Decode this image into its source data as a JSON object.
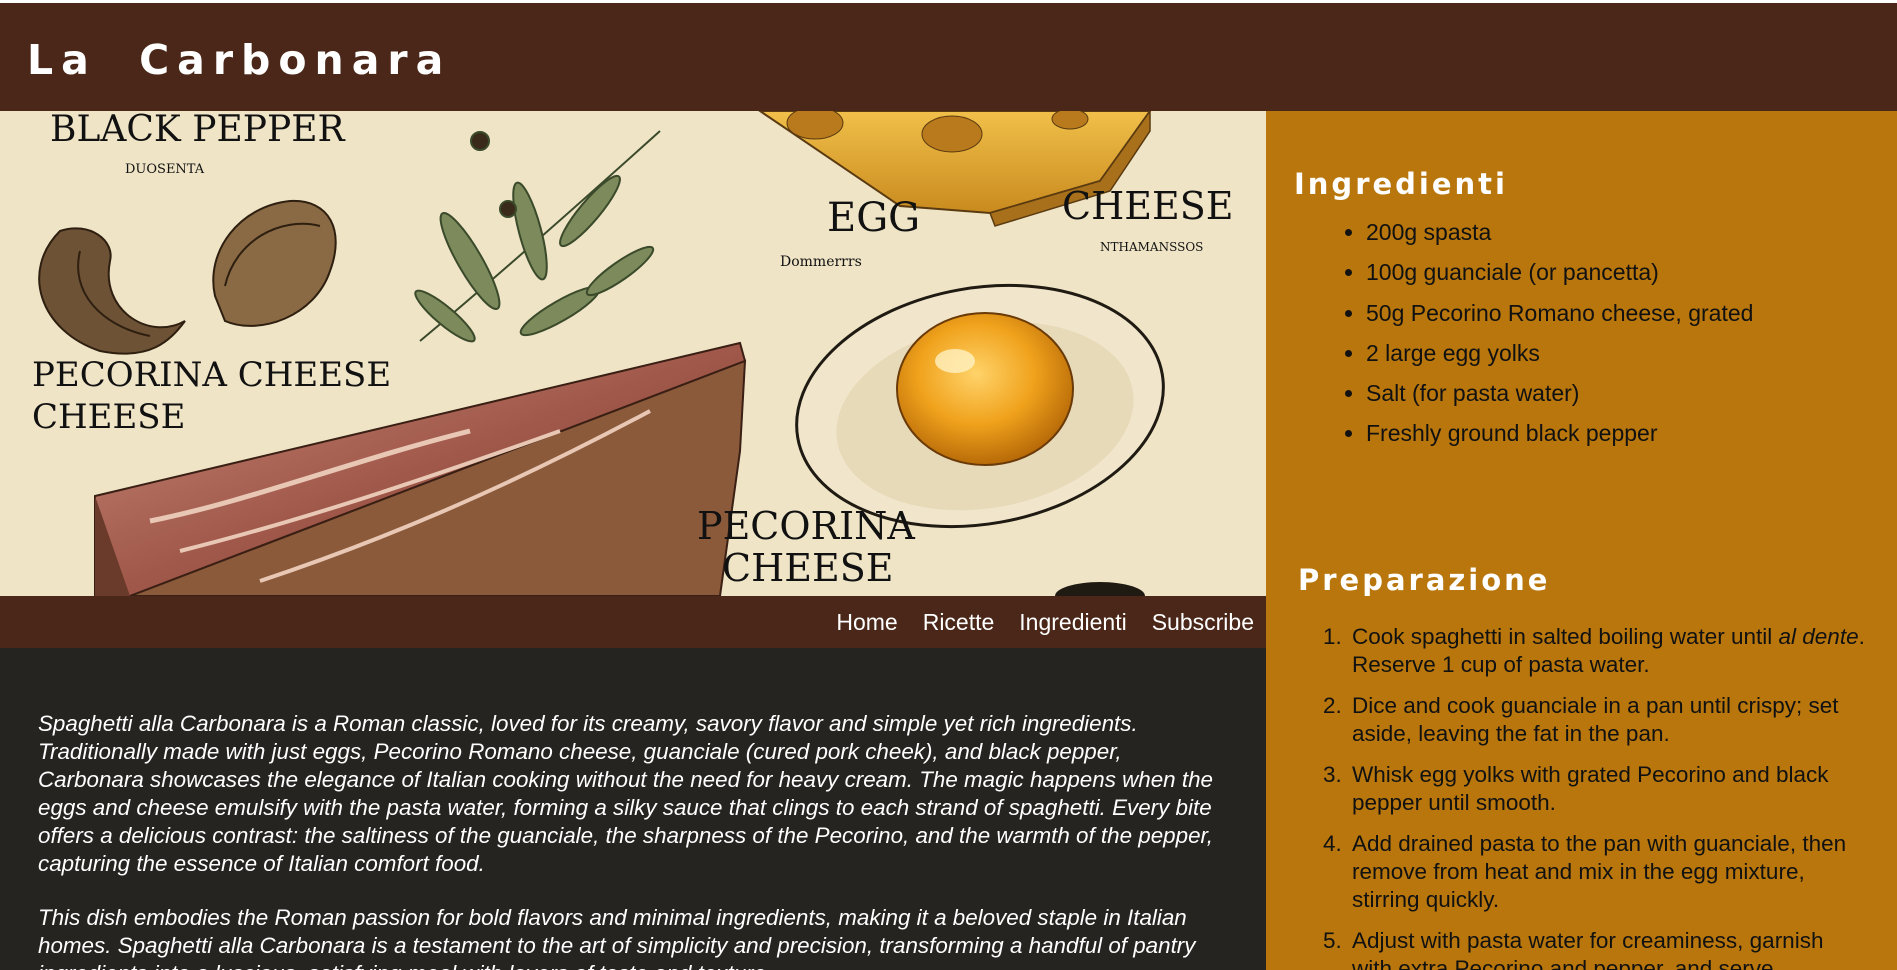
{
  "header": {
    "title": "La Carbonara"
  },
  "hero": {
    "labels": {
      "black_pepper": "BLACK PEPPER",
      "egg": "EGG",
      "cheese": "CHEESE",
      "pecorina_cheese_1_line1": "PECORINA CHEESE",
      "pecorina_cheese_1_line2": "CHEESE",
      "pecorina_cheese_2_line1": "PECORINA",
      "pecorina_cheese_2_line2": "CHEESE"
    },
    "small_captions": {
      "under_pepper": "DUOSENTA",
      "under_egg": "Dommerrrs",
      "under_cheese": "NTHAMANSSOS"
    }
  },
  "nav": {
    "items": [
      "Home",
      "Ricette",
      "Ingredienti",
      "Subscribe"
    ]
  },
  "intro": {
    "paragraph1": "Spaghetti alla Carbonara is a Roman classic, loved for its creamy, savory flavor and simple yet rich ingredients. Traditionally made with just eggs, Pecorino Romano cheese, guanciale (cured pork cheek), and black pepper, Carbonara showcases the elegance of Italian cooking without the need for heavy cream. The magic happens when the eggs and cheese emulsify with the pasta water, forming a silky sauce that clings to each strand of spaghetti. Every bite offers a delicious contrast: the saltiness of the guanciale, the sharpness of the Pecorino, and the warmth of the pepper, capturing the essence of Italian comfort food.",
    "paragraph2": "This dish embodies the Roman passion for bold flavors and minimal ingredients, making it a beloved staple in Italian homes. Spaghetti alla Carbonara is a testament to the art of simplicity and precision, transforming a handful of pantry ingredients into a luscious, satisfying meal with layers of taste and texture."
  },
  "sidebar": {
    "ingredients_title": "Ingredienti",
    "ingredients": [
      "200g spasta",
      "100g guanciale (or pancetta)",
      "50g Pecorino Romano cheese, grated",
      "2 large egg yolks",
      "Salt (for pasta water)",
      "Freshly ground black pepper"
    ],
    "preparation_title": "Preparazione",
    "steps": [
      {
        "before": "Cook spaghetti in salted boiling water until ",
        "em": "al dente",
        "after": ". Reserve 1 cup of pasta water."
      },
      {
        "before": "Dice and cook guanciale in a pan until crispy; set aside, leaving the fat in the pan.",
        "em": "",
        "after": ""
      },
      {
        "before": "Whisk egg yolks with grated Pecorino and black pepper until smooth.",
        "em": "",
        "after": ""
      },
      {
        "before": "Add drained pasta to the pan with guanciale, then remove from heat and mix in the egg mixture, stirring quickly.",
        "em": "",
        "after": ""
      },
      {
        "before": "Adjust with pasta water for creaminess, garnish with extra Pecorino and pepper, and serve.",
        "em": "",
        "after": ""
      }
    ]
  },
  "colors": {
    "header_bg": "#4a2718",
    "nav_bg": "#4a2718",
    "content_bg": "#262421",
    "sidebar_bg": "#b8760d",
    "hero_bg": "#efe4c6"
  }
}
